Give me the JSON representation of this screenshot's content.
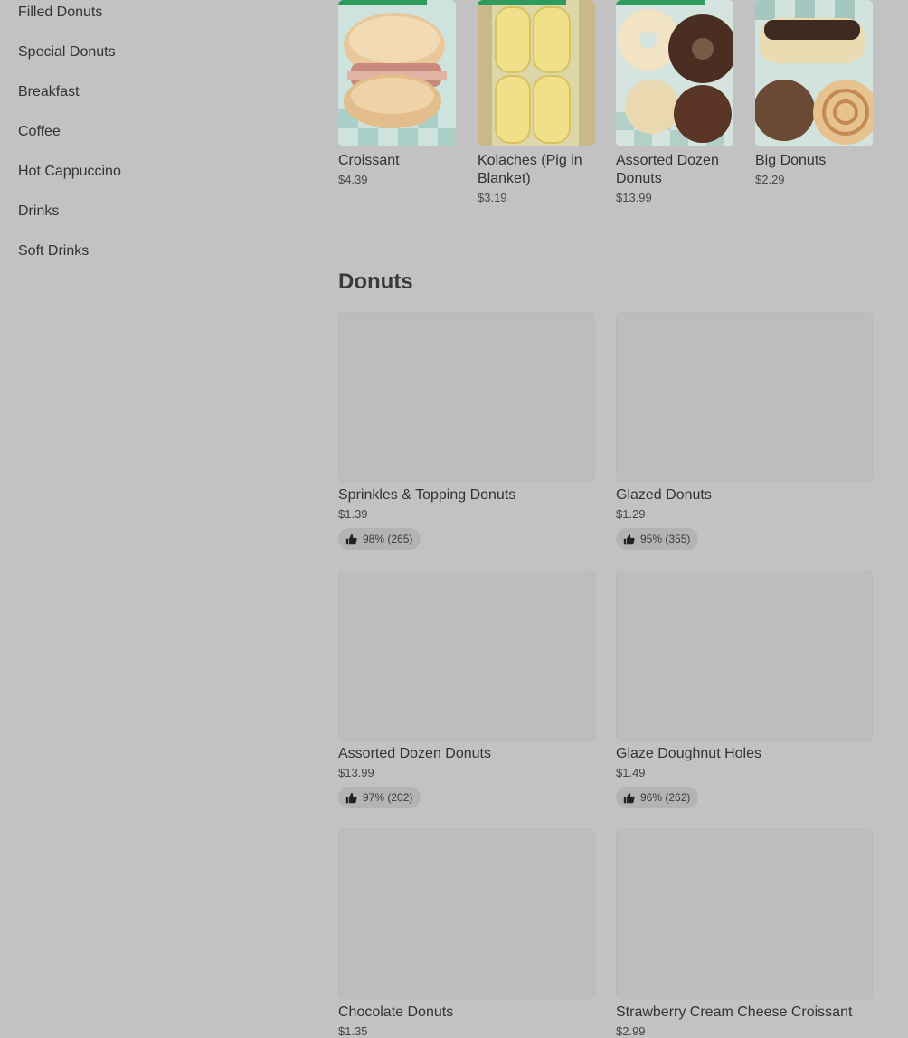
{
  "sidebar": {
    "items": [
      {
        "label": "Filled Donuts"
      },
      {
        "label": "Special Donuts"
      },
      {
        "label": "Breakfast"
      },
      {
        "label": "Coffee"
      },
      {
        "label": "Hot Cappuccino"
      },
      {
        "label": "Drinks"
      },
      {
        "label": "Soft Drinks"
      }
    ]
  },
  "featured": [
    {
      "name": "Croissant",
      "price": "$4.39"
    },
    {
      "name": "Kolaches (Pig in Blanket)",
      "price": "$3.19"
    },
    {
      "name": "Assorted Dozen Donuts",
      "price": "$13.99"
    },
    {
      "name": "Big Donuts",
      "price": "$2.29"
    }
  ],
  "section": {
    "title": "Donuts"
  },
  "items": [
    {
      "name": "Sprinkles & Topping Donuts",
      "price": "$1.39",
      "rating": "98% (265)"
    },
    {
      "name": "Glazed Donuts",
      "price": "$1.29",
      "rating": "95% (355)"
    },
    {
      "name": "Assorted Dozen Donuts",
      "price": "$13.99",
      "rating": "97% (202)"
    },
    {
      "name": "Glaze Doughnut Holes",
      "price": "$1.49",
      "rating": "96% (262)"
    },
    {
      "name": "Chocolate Donuts",
      "price": "$1.35"
    },
    {
      "name": "Strawberry Cream Cheese Croissant",
      "price": "$2.99"
    }
  ],
  "colors": {
    "tag_green": "#2e9a5c",
    "overlay": "#c2c2c2"
  }
}
